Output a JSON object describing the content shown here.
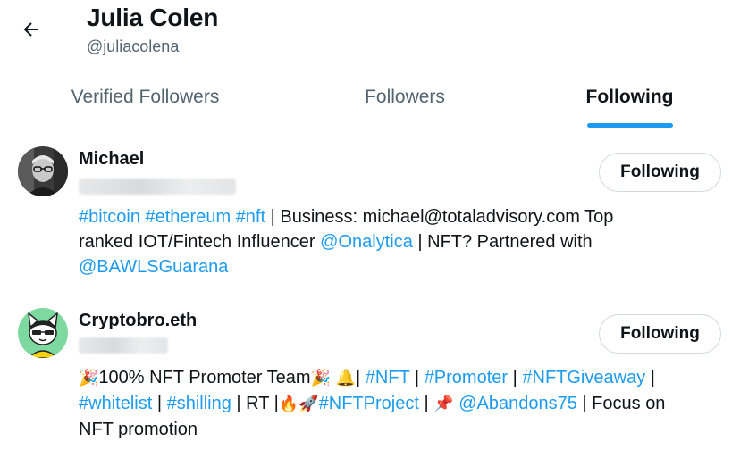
{
  "header": {
    "name": "Julia Colen",
    "handle": "@juliacolena"
  },
  "tabs": [
    {
      "label": "Verified Followers",
      "active": false
    },
    {
      "label": "Followers",
      "active": false
    },
    {
      "label": "Following",
      "active": true
    }
  ],
  "users": [
    {
      "name": "Michael",
      "handle_blurred": true,
      "button_label": "Following",
      "bio": {
        "line1": [
          {
            "text": "#bitcoin",
            "link": true
          },
          {
            "text": " ",
            "link": false
          },
          {
            "text": "#ethereum",
            "link": true
          },
          {
            "text": " ",
            "link": false
          },
          {
            "text": "#nft",
            "link": true
          },
          {
            "text": " | Business: michael@totaladvisory.com Top",
            "link": false
          }
        ],
        "line2": [
          {
            "text": "ranked IOT/Fintech Influencer ",
            "link": false
          },
          {
            "text": "@Onalytica",
            "link": true
          },
          {
            "text": " | NFT? Partnered with",
            "link": false
          }
        ],
        "line3": [
          {
            "text": "@BAWLSGuarana",
            "link": true
          }
        ]
      }
    },
    {
      "name": "Cryptobro.eth",
      "handle_blurred": true,
      "button_label": "Following",
      "bio": {
        "line1": [
          {
            "text": "🎉",
            "link": false,
            "emoji": true
          },
          {
            "text": "100% NFT Promoter Team",
            "link": false
          },
          {
            "text": "🎉",
            "link": false,
            "emoji": true
          },
          {
            "text": " ",
            "link": false
          },
          {
            "text": "🔔",
            "link": false,
            "emoji": true
          },
          {
            "text": "| ",
            "link": false
          },
          {
            "text": "#NFT",
            "link": true
          },
          {
            "text": " | ",
            "link": false
          },
          {
            "text": "#Promoter",
            "link": true
          },
          {
            "text": " | ",
            "link": false
          },
          {
            "text": "#NFTGiveaway",
            "link": true
          },
          {
            "text": " |",
            "link": false
          }
        ],
        "line2": [
          {
            "text": "#whitelist",
            "link": true
          },
          {
            "text": " | ",
            "link": false
          },
          {
            "text": "#shilling",
            "link": true
          },
          {
            "text": " | RT |",
            "link": false
          },
          {
            "text": "🔥🚀",
            "link": false,
            "emoji": true
          },
          {
            "text": "#NFTProject",
            "link": true
          },
          {
            "text": " | ",
            "link": false
          },
          {
            "text": "📌",
            "link": false,
            "emoji": true
          },
          {
            "text": " ",
            "link": false
          },
          {
            "text": "@Abandons75",
            "link": true
          },
          {
            "text": " | Focus on",
            "link": false
          }
        ],
        "line3": [
          {
            "text": "NFT promotion",
            "link": false
          }
        ]
      }
    }
  ],
  "colors": {
    "accent": "#1d9bf0",
    "text": "#0f1419",
    "muted": "#536471"
  },
  "icons": {
    "back": "arrow-left-icon"
  }
}
